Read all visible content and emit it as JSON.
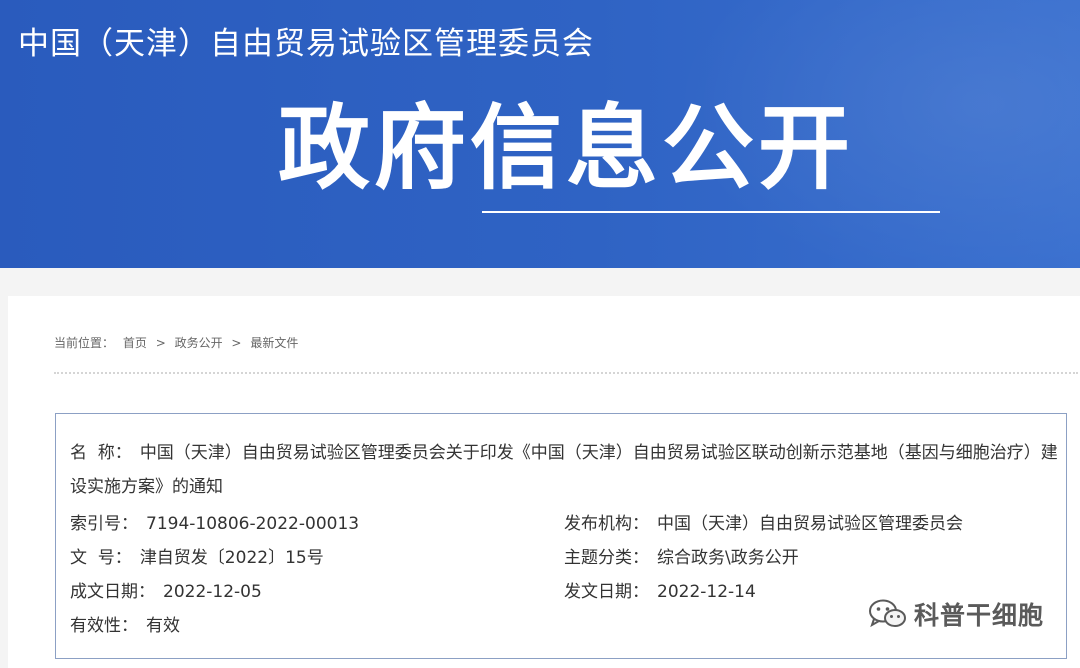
{
  "header": {
    "site_title": "中国（天津）自由贸易试验区管理委员会",
    "heading": "政府信息公开"
  },
  "breadcrumb": {
    "prefix": "当前位置：",
    "items": [
      "首页",
      "政务公开",
      "最新文件"
    ],
    "separator": ">"
  },
  "document": {
    "name_label": "名  称：",
    "name_value": "中国（天津）自由贸易试验区管理委员会关于印发《中国（天津）自由贸易试验区联动创新示范基地（基因与细胞治疗）建设实施方案》的通知",
    "index_label": "索引号：",
    "index_value": "7194-10806-2022-00013",
    "publisher_label": "发布机构：",
    "publisher_value": "中国（天津）自由贸易试验区管理委员会",
    "doc_no_label": "文  号：",
    "doc_no_value": "津自贸发〔2022〕15号",
    "category_label": "主题分类：",
    "category_value": "综合政务\\政务公开",
    "created_label": "成文日期：",
    "created_value": "2022-12-05",
    "issued_label": "发文日期：",
    "issued_value": "2022-12-14",
    "validity_label": "有效性：",
    "validity_value": "有效"
  },
  "watermark": {
    "text": "科普干细胞",
    "icon": "wechat-icon"
  },
  "colors": {
    "banner": "#2f63c4",
    "box_border": "#8ca0c4"
  }
}
